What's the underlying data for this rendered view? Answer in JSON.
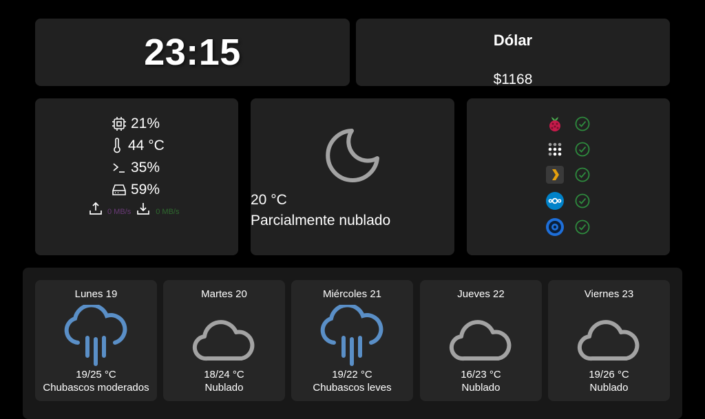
{
  "clock": {
    "time": "23:15"
  },
  "dollar": {
    "title": "Dólar",
    "value": "$1168"
  },
  "system": {
    "cpu": "21%",
    "temperature": "44 °C",
    "memory": "35%",
    "disk": "59%",
    "upload": "0 MB/s",
    "download": "0 MB/s",
    "upload_color": "#6a3a78",
    "download_color": "#2f6b2f"
  },
  "weather": {
    "icon": "moon-icon",
    "temp": "20 °C",
    "desc": "Parcialmente nublado"
  },
  "services": [
    {
      "icon": "raspberry-icon",
      "status": "check-icon"
    },
    {
      "icon": "dots-grid-icon",
      "status": "check-icon"
    },
    {
      "icon": "plex-icon",
      "status": "check-icon"
    },
    {
      "icon": "nextcloud-icon",
      "status": "check-icon"
    },
    {
      "icon": "disc-icon",
      "status": "check-icon"
    }
  ],
  "forecast": [
    {
      "day": "Lunes 19",
      "icon": "rain-icon",
      "temp": "19/25 °C",
      "desc": "Chubascos moderados"
    },
    {
      "day": "Martes 20",
      "icon": "cloud-icon",
      "temp": "18/24 °C",
      "desc": "Nublado"
    },
    {
      "day": "Miércoles 21",
      "icon": "rain-icon",
      "temp": "19/22 °C",
      "desc": "Chubascos leves"
    },
    {
      "day": "Jueves 22",
      "icon": "cloud-icon",
      "temp": "16/23 °C",
      "desc": "Nublado"
    },
    {
      "day": "Viernes 23",
      "icon": "cloud-icon",
      "temp": "19/26 °C",
      "desc": "Nublado"
    }
  ],
  "colors": {
    "rain": "#5a8fc7",
    "cloud": "#a3a3a3",
    "check": "#2e8b3e"
  }
}
